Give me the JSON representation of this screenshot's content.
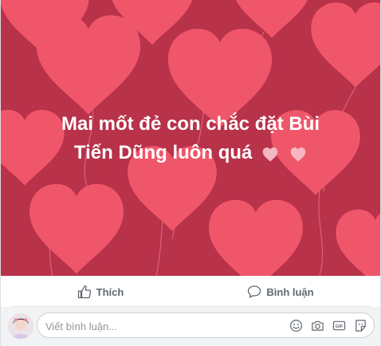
{
  "post": {
    "text_line1": "Mai mốt đẻ con chắc đặt Bùi",
    "text_line2": "Tiến Dũng luôn quá",
    "background_color": "#b8324a",
    "heart_color": "#f0566a"
  },
  "actions": {
    "like_label": "Thích",
    "comment_label": "Bình luận"
  },
  "comment": {
    "placeholder": "Viết bình luận..."
  },
  "icons": [
    "thumbs-up-icon",
    "speech-bubble-icon",
    "smiley-icon",
    "camera-icon",
    "gif-icon",
    "sticker-icon"
  ]
}
